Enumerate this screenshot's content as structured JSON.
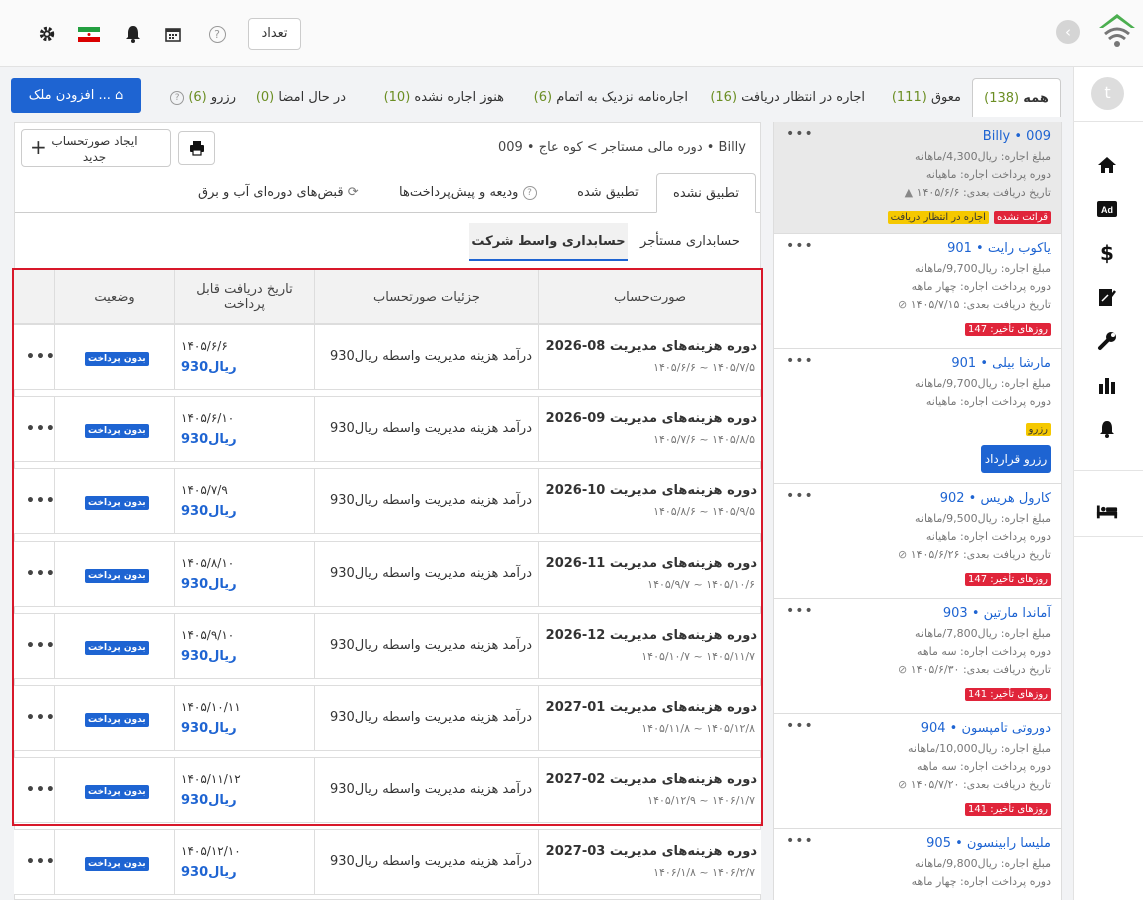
{
  "topbar": {
    "count_label": "تعداد",
    "icons": [
      "settings-icon",
      "iran-flag-icon",
      "bell-icon",
      "calendar-icon",
      "help-icon"
    ]
  },
  "tabs": [
    {
      "label": "همه",
      "count": "(138)"
    },
    {
      "label": "معوق",
      "count": "(111)"
    },
    {
      "label": "اجاره در انتظار دریافت",
      "count": "(16)"
    },
    {
      "label": "اجاره‌نامه نزدیک به اتمام",
      "count": "(6)"
    },
    {
      "label": "هنوز اجاره نشده",
      "count": "(10)"
    },
    {
      "label": "در حال امضا",
      "count": "(0)"
    },
    {
      "label": "رزرو",
      "count": "(6)"
    }
  ],
  "add_property": "افزودن ملک ...",
  "rail": {
    "avatar_letter": "t",
    "items": [
      "home-icon",
      "ad-icon",
      "dollar-icon",
      "contract-icon",
      "wrench-icon",
      "chart-icon",
      "bell-icon",
      "bed-icon"
    ]
  },
  "cards": [
    {
      "title": "Billy • 009",
      "rent": "مبلغ اجاره: ریال4,300/ماهانه",
      "period": "دوره پرداخت اجاره: ماهیانه",
      "next": "تاریخ دریافت بعدی: ۱۴۰۵/۶/۶",
      "badges": [
        "اجاره در انتظار دریافت",
        "قرائت نشده"
      ]
    },
    {
      "title": "901 • یاکوب رایت",
      "rent": "مبلغ اجاره: ریال9,700/ماهانه",
      "period": "دوره پرداخت اجاره: چهار ماهه",
      "next": "تاریخ دریافت بعدی: ۱۴۰۵/۷/۱۵",
      "late": "روزهای تأخیر: 147"
    },
    {
      "title": "901 • مارشا بیلی",
      "rent": "مبلغ اجاره: ریال9,700/ماهانه",
      "period": "دوره پرداخت اجاره: ماهیانه",
      "reserve_badge": "رزرو",
      "reserve_btn": "رزرو قرارداد"
    },
    {
      "title": "902 • کارول هریس",
      "rent": "مبلغ اجاره: ریال9,500/ماهانه",
      "period": "دوره پرداخت اجاره: ماهیانه",
      "next": "تاریخ دریافت بعدی: ۱۴۰۵/۶/۲۶",
      "late": "روزهای تأخیر: 147"
    },
    {
      "title": "903 • آماندا مارتین",
      "rent": "مبلغ اجاره: ریال7,800/ماهانه",
      "period": "دوره پرداخت اجاره: سه ماهه",
      "next": "تاریخ دریافت بعدی: ۱۴۰۵/۶/۳۰",
      "late": "روزهای تأخیر: 141"
    },
    {
      "title": "904 • دوروتی تامپسون",
      "rent": "مبلغ اجاره: ریال10,000/ماهانه",
      "period": "دوره پرداخت اجاره: سه ماهه",
      "next": "تاریخ دریافت بعدی: ۱۴۰۵/۷/۲۰",
      "late": "روزهای تأخیر: 141"
    },
    {
      "title": "905 • ملیسا رابینسون",
      "rent": "مبلغ اجاره: ریال9,800/ماهانه",
      "period": "دوره پرداخت اجاره: چهار ماهه"
    }
  ],
  "main": {
    "breadcrumb": "دوره مالی مستاجر >  کوه عاج • 009 • Billy",
    "new_invoice": "ایجاد صورتحساب جدید",
    "subtabs": [
      "تطبیق نشده",
      "تطبیق شده",
      "ودیعه و پیش‌پرداخت‌ها",
      "قبض‌های دوره‌ای آب و برق"
    ],
    "acct_tabs": [
      "حسابداری مستأجر",
      "حسابداری واسط شرکت"
    ],
    "headers": [
      "صورت‌حساب",
      "جزئیات صورتحساب",
      "تاریخ دریافت قابل پرداخت",
      "وضعیت"
    ],
    "rows": [
      {
        "title": "2026-08 دوره هزینه‌های مدیریت",
        "range": "۱۴۰۵/۶/۶ ~ ۱۴۰۵/۷/۵",
        "detail": "درآمد هزینه مدیریت واسطه  ریال930",
        "due": "۱۴۰۵/۶/۶",
        "amount": "ریال930",
        "status": "بدون پرداخت"
      },
      {
        "title": "2026-09 دوره هزینه‌های مدیریت",
        "range": "۱۴۰۵/۷/۶ ~ ۱۴۰۵/۸/۵",
        "detail": "درآمد هزینه مدیریت واسطه  ریال930",
        "due": "۱۴۰۵/۶/۱۰",
        "amount": "ریال930",
        "status": "بدون پرداخت"
      },
      {
        "title": "2026-10 دوره هزینه‌های مدیریت",
        "range": "۱۴۰۵/۸/۶ ~ ۱۴۰۵/۹/۵",
        "detail": "درآمد هزینه مدیریت واسطه  ریال930",
        "due": "۱۴۰۵/۷/۹",
        "amount": "ریال930",
        "status": "بدون پرداخت"
      },
      {
        "title": "2026-11 دوره هزینه‌های مدیریت",
        "range": "۱۴۰۵/۹/۷ ~ ۱۴۰۵/۱۰/۶",
        "detail": "درآمد هزینه مدیریت واسطه  ریال930",
        "due": "۱۴۰۵/۸/۱۰",
        "amount": "ریال930",
        "status": "بدون پرداخت"
      },
      {
        "title": "2026-12 دوره هزینه‌های مدیریت",
        "range": "۱۴۰۵/۱۰/۷ ~ ۱۴۰۵/۱۱/۷",
        "detail": "درآمد هزینه مدیریت واسطه  ریال930",
        "due": "۱۴۰۵/۹/۱۰",
        "amount": "ریال930",
        "status": "بدون پرداخت"
      },
      {
        "title": "2027-01 دوره هزینه‌های مدیریت",
        "range": "۱۴۰۵/۱۱/۸ ~ ۱۴۰۵/۱۲/۸",
        "detail": "درآمد هزینه مدیریت واسطه  ریال930",
        "due": "۱۴۰۵/۱۰/۱۱",
        "amount": "ریال930",
        "status": "بدون پرداخت"
      },
      {
        "title": "2027-02 دوره هزینه‌های مدیریت",
        "range": "۱۴۰۵/۱۲/۹ ~ ۱۴۰۶/۱/۷",
        "detail": "درآمد هزینه مدیریت واسطه  ریال930",
        "due": "۱۴۰۵/۱۱/۱۲",
        "amount": "ریال930",
        "status": "بدون پرداخت"
      },
      {
        "title": "2027-03 دوره هزینه‌های مدیریت",
        "range": "۱۴۰۶/۱/۸ ~ ۱۴۰۶/۲/۷",
        "detail": "درآمد هزینه مدیریت واسطه  ریال930",
        "due": "۱۴۰۵/۱۲/۱۰",
        "amount": "ریال930",
        "status": "بدون پرداخت"
      }
    ]
  }
}
